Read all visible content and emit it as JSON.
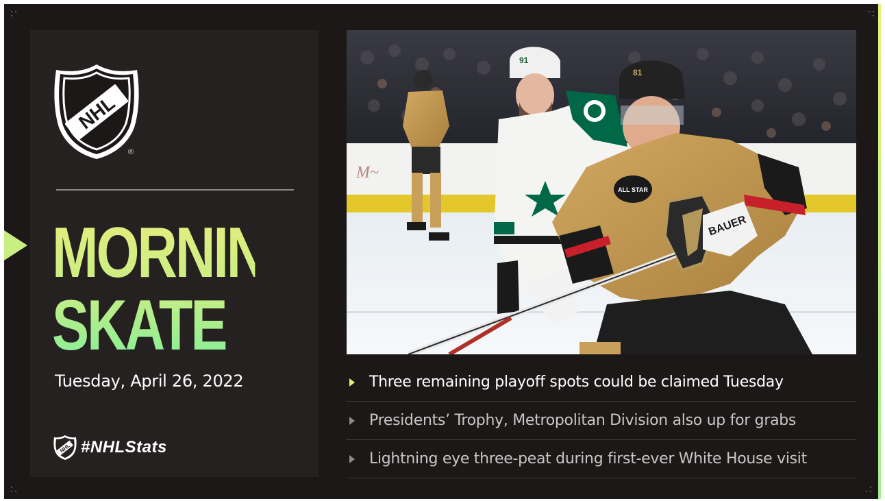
{
  "brand": {
    "league": "NHL",
    "registered_mark": "®"
  },
  "feature": {
    "title_line1": "MORNING",
    "title_line2": "SKATE",
    "date": "Tuesday, April 26, 2022",
    "hashtag": "#NHLStats"
  },
  "photo": {
    "away_jersey_number": "91",
    "home_jersey_number": "81",
    "stick_brand": "BAUER",
    "patch": "ALL STAR"
  },
  "headlines": [
    {
      "text": "Three remaining playoff spots could be claimed Tuesday",
      "active": true
    },
    {
      "text": "Presidents’ Trophy, Metropolitan Division also up for grabs",
      "active": false
    },
    {
      "text": "Lightning eye three-peat during first-ever White House visit",
      "active": false
    }
  ],
  "colors": {
    "background": "#1c1818",
    "panel": "#262121",
    "accent_yellow": "#e4ee7c",
    "accent_green": "#86ee98",
    "vegas_gold": "#b4975a",
    "stars_green": "#006847"
  }
}
